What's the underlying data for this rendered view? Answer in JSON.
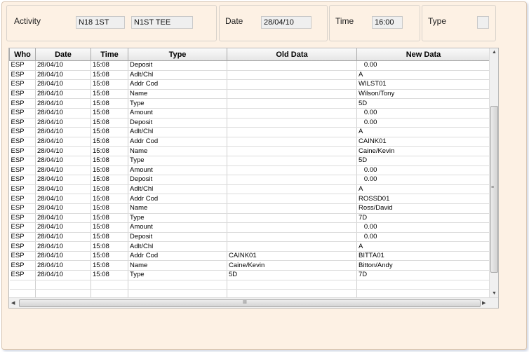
{
  "header": {
    "activity_label": "Activity",
    "activity_code1": "N18 1ST",
    "activity_code2": "N1ST TEE",
    "date_label": "Date",
    "date_value": "28/04/10",
    "time_label": "Time",
    "time_value": "16:00",
    "type_label": "Type",
    "type_value": ""
  },
  "grid": {
    "columns": [
      "Who",
      "Date",
      "Time",
      "Type",
      "Old Data",
      "New Data"
    ],
    "rows": [
      [
        "ESP",
        "28/04/10",
        "15:08",
        "Deposit",
        "",
        "   0.00"
      ],
      [
        "ESP",
        "28/04/10",
        "15:08",
        "Adlt/Chl",
        "",
        "A"
      ],
      [
        "ESP",
        "28/04/10",
        "15:08",
        "Addr Cod",
        "",
        "WILST01"
      ],
      [
        "ESP",
        "28/04/10",
        "15:08",
        "Name",
        "",
        "Wilson/Tony"
      ],
      [
        "ESP",
        "28/04/10",
        "15:08",
        "Type",
        "",
        "5D"
      ],
      [
        "ESP",
        "28/04/10",
        "15:08",
        "Amount",
        "",
        "   0.00"
      ],
      [
        "ESP",
        "28/04/10",
        "15:08",
        "Deposit",
        "",
        "   0.00"
      ],
      [
        "ESP",
        "28/04/10",
        "15:08",
        "Adlt/Chl",
        "",
        "A"
      ],
      [
        "ESP",
        "28/04/10",
        "15:08",
        "Addr Cod",
        "",
        "CAINK01"
      ],
      [
        "ESP",
        "28/04/10",
        "15:08",
        "Name",
        "",
        "Caine/Kevin"
      ],
      [
        "ESP",
        "28/04/10",
        "15:08",
        "Type",
        "",
        "5D"
      ],
      [
        "ESP",
        "28/04/10",
        "15:08",
        "Amount",
        "",
        "   0.00"
      ],
      [
        "ESP",
        "28/04/10",
        "15:08",
        "Deposit",
        "",
        "   0.00"
      ],
      [
        "ESP",
        "28/04/10",
        "15:08",
        "Adlt/Chl",
        "",
        "A"
      ],
      [
        "ESP",
        "28/04/10",
        "15:08",
        "Addr Cod",
        "",
        "ROSSD01"
      ],
      [
        "ESP",
        "28/04/10",
        "15:08",
        "Name",
        "",
        "Ross/David"
      ],
      [
        "ESP",
        "28/04/10",
        "15:08",
        "Type",
        "",
        "7D"
      ],
      [
        "ESP",
        "28/04/10",
        "15:08",
        "Amount",
        "",
        "   0.00"
      ],
      [
        "ESP",
        "28/04/10",
        "15:08",
        "Deposit",
        "",
        "   0.00"
      ],
      [
        "ESP",
        "28/04/10",
        "15:08",
        "Adlt/Chl",
        "",
        "A"
      ],
      [
        "ESP",
        "28/04/10",
        "15:08",
        "Addr Cod",
        "CAINK01",
        "BITTA01"
      ],
      [
        "ESP",
        "28/04/10",
        "15:08",
        "Name",
        "Caine/Kevin",
        "Bitton/Andy"
      ],
      [
        "ESP",
        "28/04/10",
        "15:08",
        "Type",
        "5D",
        "7D"
      ]
    ],
    "hscroll_grip": "III",
    "vscroll_grip": "≡"
  },
  "icons": {
    "scroll_up": "arrow-up-icon",
    "scroll_down": "arrow-down-icon",
    "scroll_left": "arrow-left-icon",
    "scroll_right": "arrow-right-icon"
  }
}
